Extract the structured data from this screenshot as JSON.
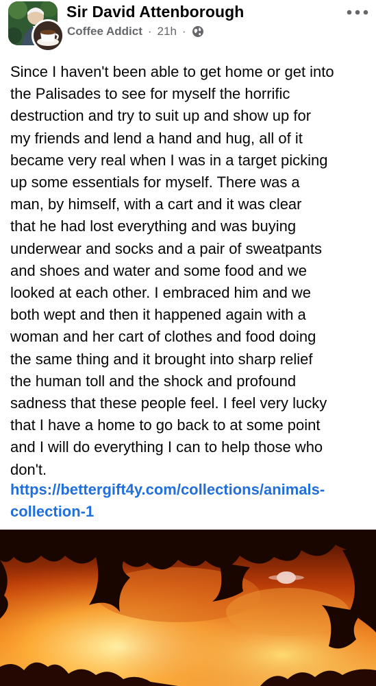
{
  "post": {
    "author": "Sir David Attenborough",
    "group": "Coffee Addict",
    "separator": "·",
    "time": "21h",
    "audience_icon": "globe-icon",
    "more_icon": "more-options-icon",
    "body_lines": [
      "Since I haven't been able to get home or get into",
      "the Palisades to see for myself the horrific",
      "destruction and try to suit up and show up for",
      "my friends and lend a hand and hug, all of it",
      "became very real when I was in a target picking",
      "up some essentials for myself. There was a",
      "man, by himself, with a cart and it was clear",
      "that he had lost everything and was buying",
      "underwear and socks and a pair of sweatpants",
      "and shoes and water and some food and we",
      "looked at each other. I embraced him and we",
      "both wept and then it happened again with a",
      "woman and her cart of clothes and food doing",
      "the same thing and it brought into sharp relief",
      "the human toll and the shock and profound",
      "sadness that these people feel. I feel very lucky",
      "that I have a home to go back to at some point",
      "and I will do everything I can to help those who",
      "don't."
    ],
    "link_lines": [
      "https://bettergift4y.com/collections/animals-",
      "collection-1"
    ]
  },
  "colors": {
    "text": "#050505",
    "meta": "#65676b",
    "link": "#216fdb",
    "background": "#ffffff"
  }
}
